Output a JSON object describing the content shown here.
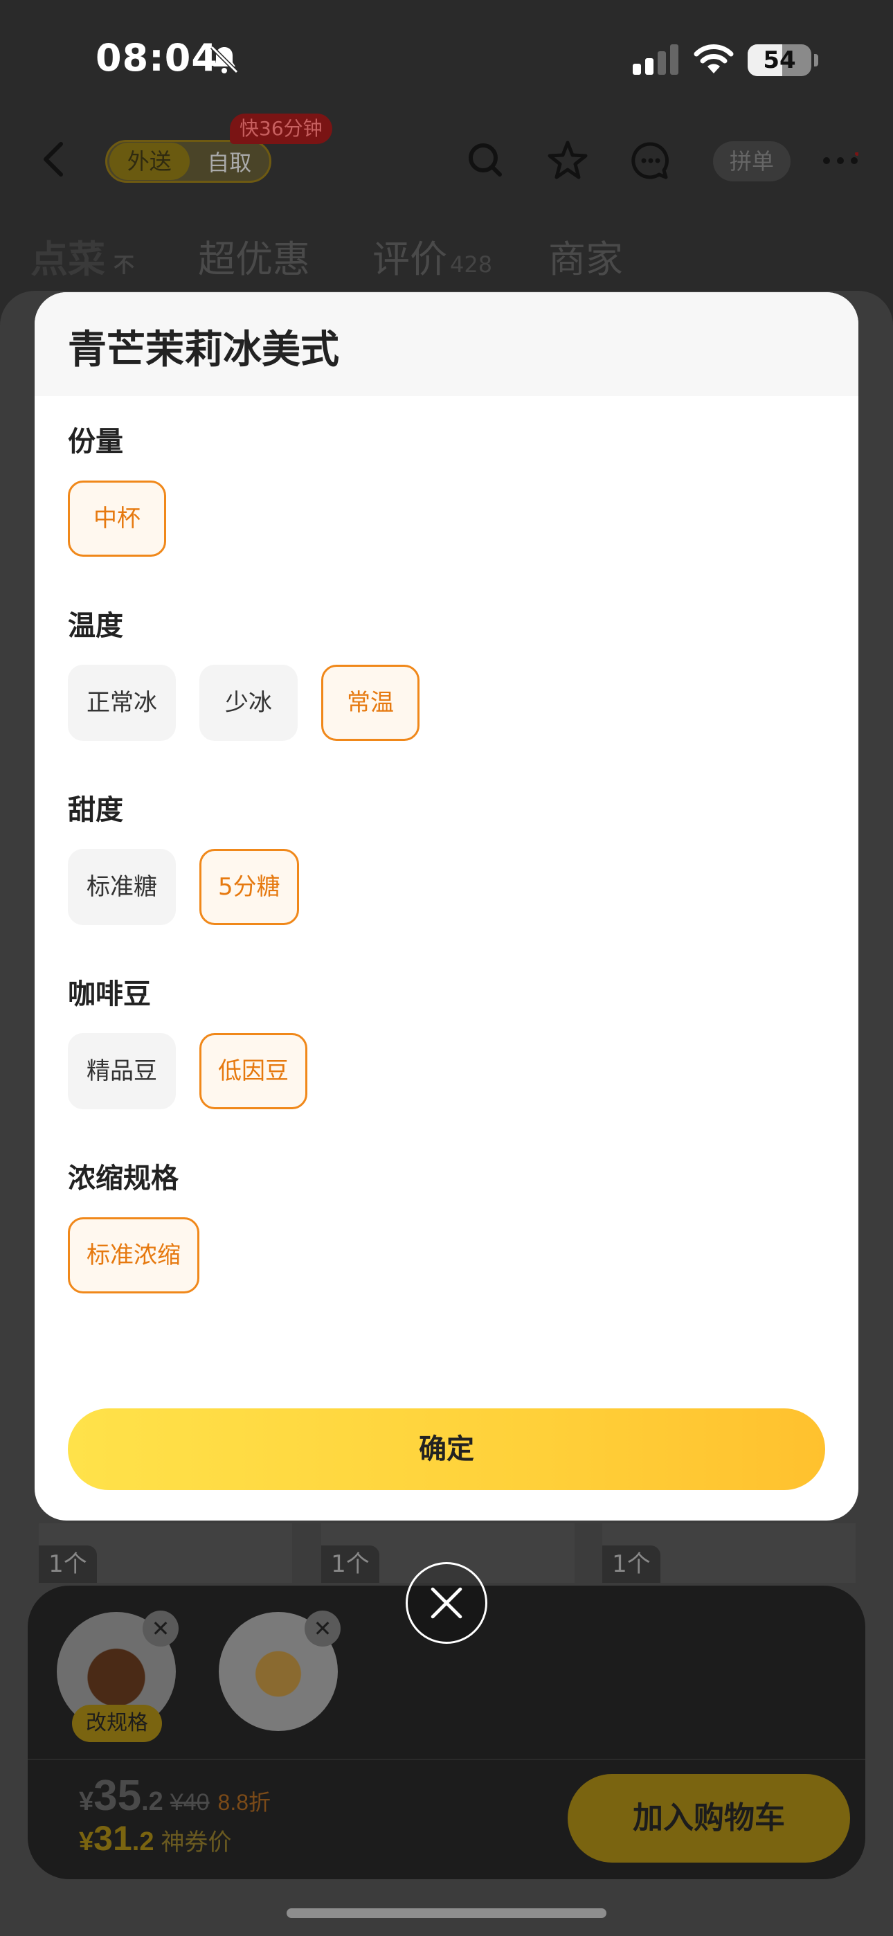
{
  "status_bar": {
    "time": "08:04",
    "battery": "54",
    "battery_level": 0.54
  },
  "nav": {
    "modes": [
      "外送",
      "自取"
    ],
    "eta_badge": "快36分钟",
    "group_order": "拼单"
  },
  "tabs": [
    {
      "label": "点菜",
      "sub": "不"
    },
    {
      "label": "超优惠"
    },
    {
      "label": "评价",
      "count": "428"
    },
    {
      "label": "商家"
    }
  ],
  "modal": {
    "title": "青芒茉莉冰美式",
    "groups": [
      {
        "label": "份量",
        "options": [
          "中杯"
        ],
        "selected": 0
      },
      {
        "label": "温度",
        "options": [
          "正常冰",
          "少冰",
          "常温"
        ],
        "selected": 2
      },
      {
        "label": "甜度",
        "options": [
          "标准糖",
          "5分糖"
        ],
        "selected": 1
      },
      {
        "label": "咖啡豆",
        "options": [
          "精品豆",
          "低因豆"
        ],
        "selected": 1
      },
      {
        "label": "浓缩规格",
        "options": [
          "标准浓缩"
        ],
        "selected": 0
      }
    ],
    "confirm": "确定"
  },
  "thumbs": [
    {
      "count": "1个"
    },
    {
      "count": "1个"
    },
    {
      "count": "1个"
    }
  ],
  "cart": {
    "remove_symbol": "✕",
    "spec_badge": "改规格",
    "currency": "¥",
    "price_int": "35",
    "price_dec": ".2",
    "original_price": "¥40",
    "discount": "8.8折",
    "coupon_price_int": "31",
    "coupon_price_dec": ".2",
    "coupon_label": "神券价",
    "add_to_cart": "加入购物车"
  }
}
